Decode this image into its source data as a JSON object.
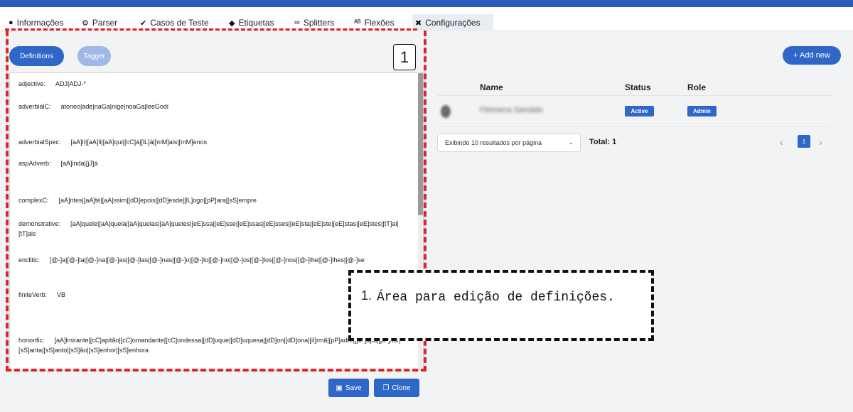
{
  "tabs": [
    {
      "icon": "info-icon",
      "glyph": "●",
      "label": "Informações"
    },
    {
      "icon": "gears-icon",
      "glyph": "⚙",
      "label": "Parser"
    },
    {
      "icon": "check-circle-icon",
      "glyph": "✔",
      "label": "Casos de Teste"
    },
    {
      "icon": "tag-icon",
      "glyph": "◆",
      "label": "Etiquetas"
    },
    {
      "icon": "link-icon",
      "glyph": "∞",
      "label": "Splitters"
    },
    {
      "icon": "spellcheck-icon",
      "glyph": "ᴬᴮ",
      "label": "Flexões"
    },
    {
      "icon": "tools-icon",
      "glyph": "✖",
      "label": "Configurações"
    }
  ],
  "editor": {
    "modes": {
      "definitions": "Definitions",
      "tagger": "Tagger"
    },
    "annotation_number": "1",
    "lines": [
      {
        "label": "adjective:",
        "value": "ADJ|ADJ-*"
      },
      {
        "label": "adverbialC:",
        "value": "atoneo|ade|naGa|nige|noaGa|leeGodi"
      },
      {
        "label": "adverbialSpec:",
        "value": "[aA]lí|[aA]li|[aA]qui|[cC]á|[lL]á|[mM]ais|[mM]enos"
      },
      {
        "label": "aspAdverb:",
        "value": "[aA]inda|[jJ]á"
      },
      {
        "label": "complexC:",
        "value": "[aA]ntes|[aA]té|[aA]ssim|[dD]epois|[dD]esde|[lL]ogo|[pP]ara|[sS]empre"
      },
      {
        "label": "demonstrative:",
        "value": "[aA]quele|[aA]quela|[aA]quelas|[aA]queles|[eE]ssa|[eE]sse|[eE]ssas|[eE]sses|[eE]sta|[eE]ste|[eE]stas|[eE]stes|[tT]al|[tT]ais"
      },
      {
        "label": "enclitic:",
        "value": "[@-]a|[@-]la|[@-]na|[@-]as|[@-]las|[@-]nas|[@-]o|[@-]lo|[@-]no|[@-]os|[@-]los|[@-]nos|[@-]lhe|[@-]lhes|[@-]se"
      },
      {
        "label": "finiteVerb:",
        "value": "VB"
      },
      {
        "label": "honorific:",
        "value": "[aA]lmirante|[cC]apitão|[cC]omandante|[cC]ondessa|[dD]uque|[dD]uquesa|[dD]on|[dD]ona|[iI]rmã|[pP]adre|[pP]apa|[pP]rior|[sS]anta|[sS]anto|[sS]ão|[sS]enhor|[sS]enhora"
      }
    ],
    "save_label": "Save",
    "clone_label": "Clone"
  },
  "users": {
    "add_label": "+ Add new",
    "columns": [
      "Name",
      "Status",
      "Role"
    ],
    "rows": [
      {
        "name": "Filomena Sandalo",
        "status": "Active",
        "role": "Admin"
      }
    ],
    "page_size_label": "Exibindo 10 resultados por página",
    "total_label": "Total: 1",
    "current_page": "1",
    "prev_glyph": "‹",
    "next_glyph": "›"
  },
  "callout": {
    "number": "1.",
    "text": "Área para edição de definições."
  },
  "colors": {
    "accent": "#2f67c9",
    "highlight": "#e02424",
    "topbar": "#2a5bb8"
  }
}
